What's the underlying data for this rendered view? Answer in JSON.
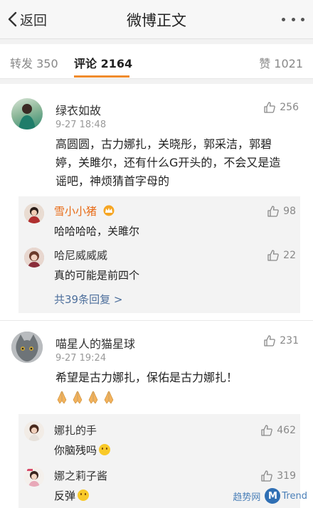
{
  "nav": {
    "back_label": "返回",
    "title": "微博正文"
  },
  "tabs": {
    "repost": "转发 350",
    "comment": "评论 2164",
    "like": "赞 1021"
  },
  "comments": [
    {
      "user": "绿衣如故",
      "time": "9-27 18:48",
      "likes": "256",
      "text_lines": [
        "高圆圆，古力娜扎，关晓彤，郭采洁，郭碧",
        "婷，关雎尔，还有什么G开头的，不会又是造",
        "谣吧，神烦猜首字母的"
      ],
      "replies": [
        {
          "user": "雪小小猪",
          "text": "哈哈哈哈，关雎尔",
          "likes": "98"
        },
        {
          "user": "哈尼威威威",
          "text": "真的可能是前四个",
          "likes": "22"
        }
      ],
      "more_replies": "共39条回复 >"
    },
    {
      "user": "喵星人的猫星球",
      "time": "9-27 19:24",
      "likes": "231",
      "text": "希望是古力娜扎，保佑是古力娜扎！",
      "replies": [
        {
          "user": "娜扎的手",
          "text": "你脑残吗",
          "likes": "462"
        },
        {
          "user": "娜之莉子酱",
          "text": "反弹",
          "likes": "319"
        }
      ]
    }
  ],
  "watermark": {
    "prefix": "趋势网",
    "suffix": "Trend",
    "logo": "M"
  }
}
